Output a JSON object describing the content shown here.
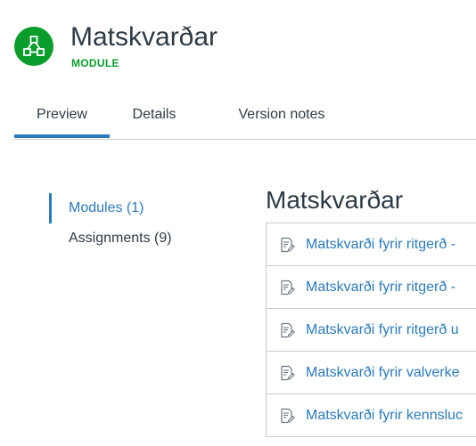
{
  "header": {
    "title": "Matskvarðar",
    "subtitle": "MODULE",
    "icon": "module-icon",
    "accent": "#0b9d2c"
  },
  "tabs": [
    {
      "label": "Preview",
      "active": true
    },
    {
      "label": "Details",
      "active": false
    },
    {
      "label": "Version notes",
      "active": false
    }
  ],
  "sidenav": {
    "items": [
      {
        "label": "Modules (1)",
        "active": true
      },
      {
        "label": "Assignments (9)",
        "active": false
      }
    ]
  },
  "section": {
    "title": "Matskvarðar",
    "items": [
      {
        "label": "Matskvarði fyrir ritgerð -",
        "icon": "assignment-icon"
      },
      {
        "label": "Matskvarði fyrir ritgerð -",
        "icon": "assignment-icon"
      },
      {
        "label": "Matskvarði fyrir ritgerð u",
        "icon": "assignment-icon"
      },
      {
        "label": "Matskvarði fyrir valverke",
        "icon": "assignment-icon"
      },
      {
        "label": "Matskvarði fyrir kennsluc",
        "icon": "assignment-icon"
      }
    ]
  },
  "colors": {
    "link": "#2b7abc",
    "text": "#2d3b45",
    "border": "#c7cdd1"
  }
}
